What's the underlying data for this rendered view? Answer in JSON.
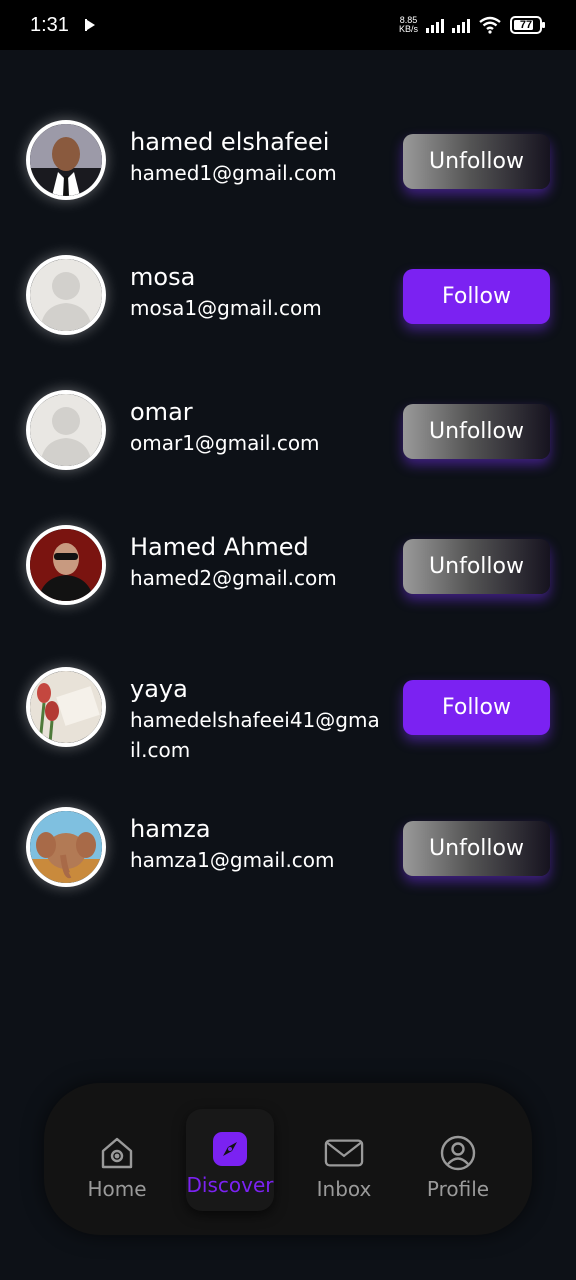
{
  "status_bar": {
    "time": "1:31",
    "net_speed_value": "8.85",
    "net_speed_unit": "KB/s",
    "battery": "77"
  },
  "users": [
    {
      "name": "hamed elshafeei",
      "email": "hamed1@gmail.com",
      "button": "Unfollow",
      "following": true,
      "avatar": "man-suit-photo"
    },
    {
      "name": "mosa",
      "email": "mosa1@gmail.com",
      "button": "Follow",
      "following": false,
      "avatar": "default-avatar"
    },
    {
      "name": "omar",
      "email": "omar1@gmail.com",
      "button": "Unfollow",
      "following": true,
      "avatar": "default-avatar"
    },
    {
      "name": "Hamed Ahmed",
      "email": "hamed2@gmail.com",
      "button": "Unfollow",
      "following": true,
      "avatar": "man-sunglasses-photo"
    },
    {
      "name": "yaya",
      "email": "hamedelshafeei41@gmail.com",
      "button": "Follow",
      "following": false,
      "avatar": "tulips-photo"
    },
    {
      "name": "hamza",
      "email": "hamza1@gmail.com",
      "button": "Unfollow",
      "following": true,
      "avatar": "elephant-illustration"
    }
  ],
  "nav": {
    "items": [
      {
        "label": "Home",
        "icon": "home-icon",
        "active": false
      },
      {
        "label": "Discover",
        "icon": "compass-icon",
        "active": true
      },
      {
        "label": "Inbox",
        "icon": "mail-icon",
        "active": false
      },
      {
        "label": "Profile",
        "icon": "profile-icon",
        "active": false
      }
    ]
  },
  "colors": {
    "background": "#0d1117",
    "accent": "#7b22f2",
    "nav_background": "#131313"
  }
}
